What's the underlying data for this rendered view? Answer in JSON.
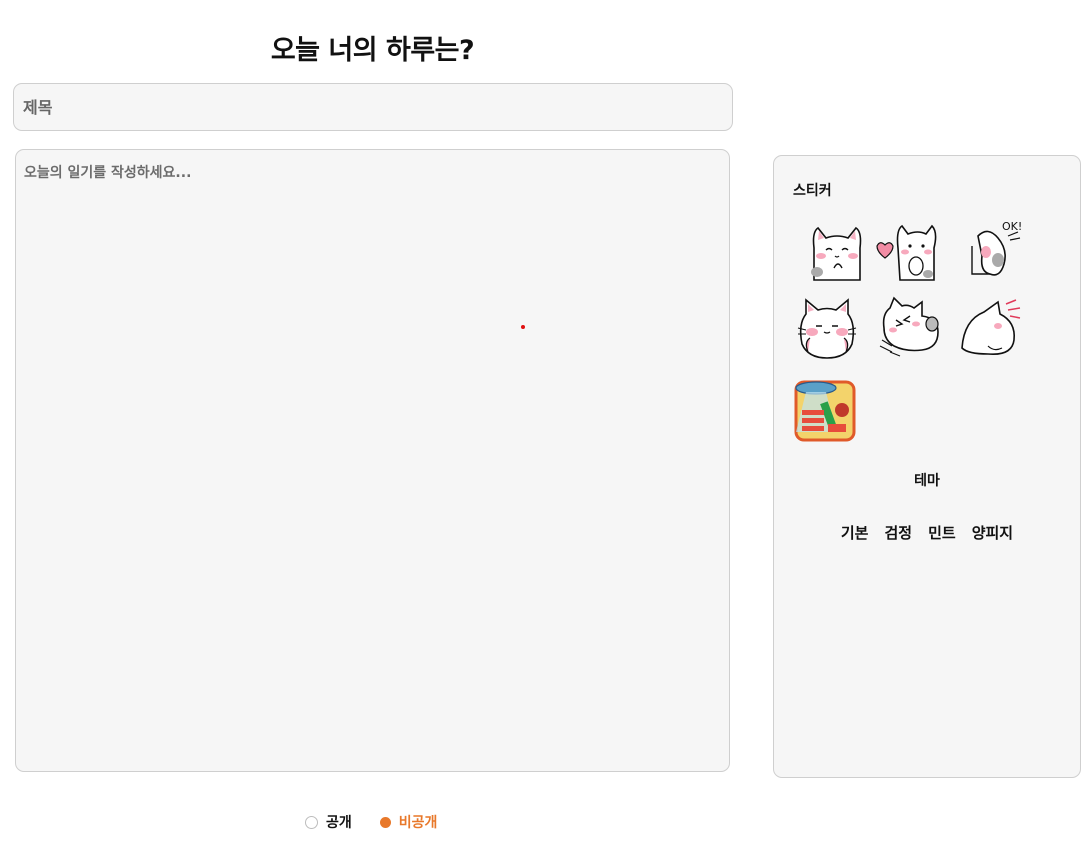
{
  "page": {
    "title": "오늘 너의 하루는?"
  },
  "form": {
    "title_placeholder": "제목",
    "content_placeholder": "오늘의 일기를 작성하세요..."
  },
  "sidebar": {
    "sticker_heading": "스티커",
    "stickers": [
      {
        "icon": "cat-peeking-sticker"
      },
      {
        "icon": "cat-heart-sticker"
      },
      {
        "icon": "cat-ok-sticker"
      },
      {
        "icon": "cat-blushing-sticker"
      },
      {
        "icon": "cat-lying-sticker"
      },
      {
        "icon": "cat-back-sticker"
      },
      {
        "icon": "ufo-cartoon-sticker"
      }
    ],
    "theme_heading": "테마",
    "themes": [
      "기본",
      "검정",
      "민트",
      "양피지"
    ]
  },
  "visibility": {
    "options": [
      "공개",
      "비공개"
    ],
    "selected": "비공개",
    "accent_color": "#e8782a"
  }
}
